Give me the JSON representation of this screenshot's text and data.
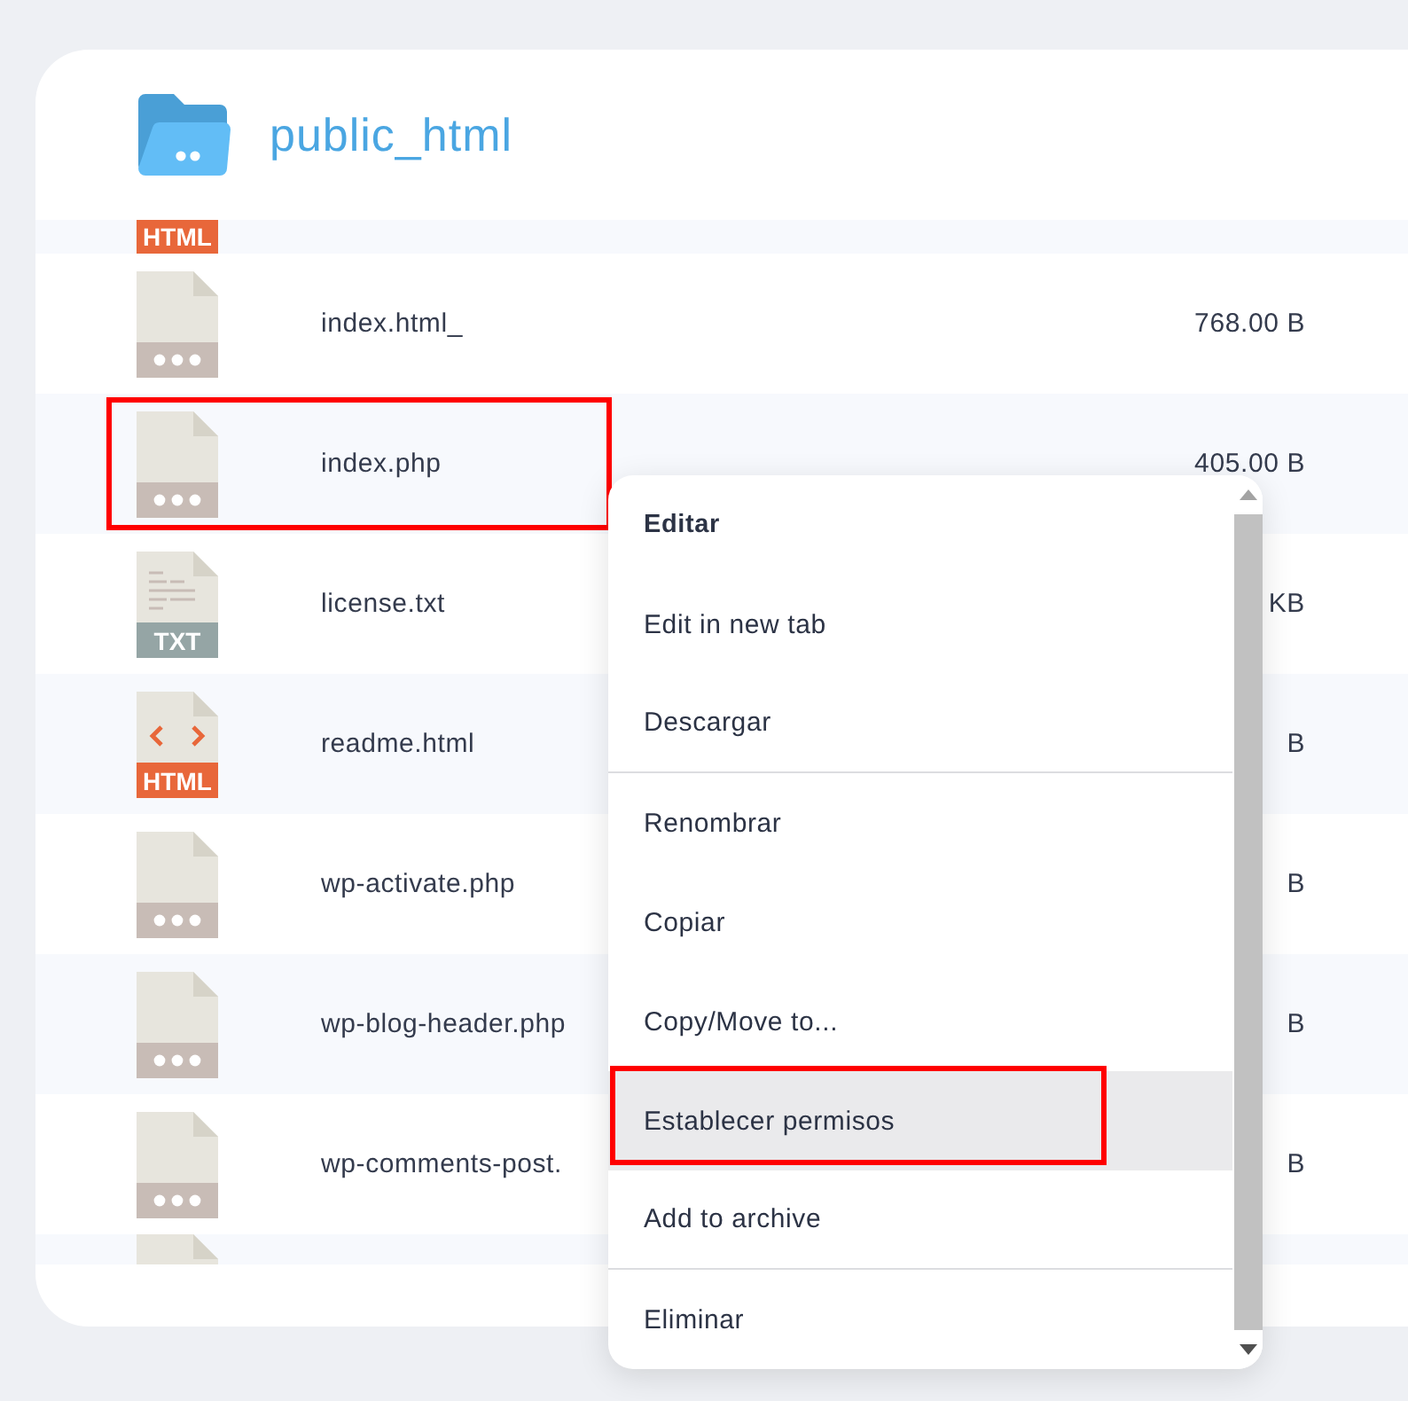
{
  "folder": {
    "title": "public_html"
  },
  "clipped_top_row": {
    "kind": "html",
    "icon_label": "HTML"
  },
  "files": [
    {
      "kind": "generic",
      "name": "index.html_",
      "size": "768.00 B",
      "highlighted": false
    },
    {
      "kind": "generic",
      "name": "index.php",
      "size": "405.00 B",
      "highlighted": true
    },
    {
      "kind": "txt",
      "icon_label": "TXT",
      "name": "license.txt",
      "size": "KB",
      "highlighted": false
    },
    {
      "kind": "html",
      "icon_label": "HTML",
      "name": "readme.html",
      "size": "B",
      "highlighted": false
    },
    {
      "kind": "generic",
      "name": "wp-activate.php",
      "size": "B",
      "highlighted": false
    },
    {
      "kind": "generic",
      "name": "wp-blog-header.php",
      "size": "B",
      "highlighted": false
    },
    {
      "kind": "generic",
      "name": "wp-comments-post.",
      "size": "B",
      "highlighted": false
    }
  ],
  "clipped_bottom_row": {
    "kind": "generic"
  },
  "context_menu": {
    "items": [
      {
        "label": "Editar",
        "bold": true,
        "selected": false,
        "highlighted": false,
        "divider_after": false
      },
      {
        "label": "Edit in new tab",
        "bold": false,
        "selected": false,
        "highlighted": false,
        "divider_after": false
      },
      {
        "label": "Descargar",
        "bold": false,
        "selected": false,
        "highlighted": false,
        "divider_after": true
      },
      {
        "label": "Renombrar",
        "bold": false,
        "selected": false,
        "highlighted": false,
        "divider_after": false
      },
      {
        "label": "Copiar",
        "bold": false,
        "selected": false,
        "highlighted": false,
        "divider_after": false
      },
      {
        "label": "Copy/Move to...",
        "bold": false,
        "selected": false,
        "highlighted": false,
        "divider_after": false
      },
      {
        "label": "Establecer permisos",
        "bold": false,
        "selected": true,
        "highlighted": true,
        "divider_after": false
      },
      {
        "label": "Add to archive",
        "bold": false,
        "selected": false,
        "highlighted": false,
        "divider_after": true
      },
      {
        "label": "Eliminar",
        "bold": false,
        "selected": false,
        "highlighted": false,
        "divider_after": false
      }
    ]
  }
}
